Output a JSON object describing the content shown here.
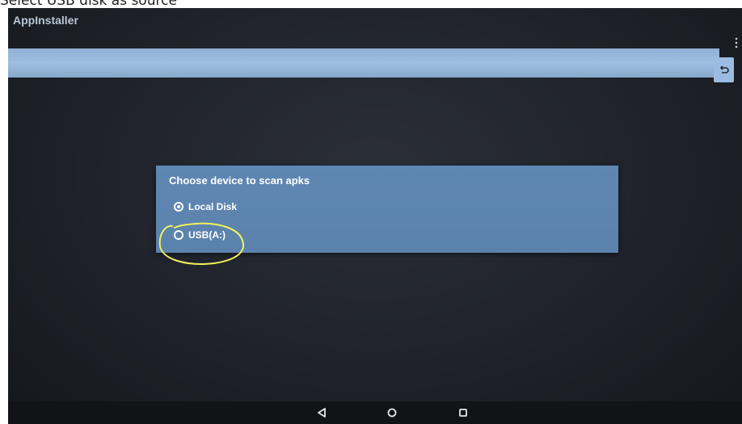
{
  "caption": "Select USB disk as source",
  "app": {
    "title": "AppInstaller"
  },
  "dialog": {
    "title": "Choose device to scan apks",
    "options": [
      {
        "label": "Local Disk",
        "selected": true
      },
      {
        "label": "USB(A:)",
        "selected": false
      }
    ]
  },
  "icons": {
    "overflow": "more-vert-icon",
    "back": "return-arrow-icon",
    "nav": [
      "back-triangle-icon",
      "home-circle-icon",
      "recents-square-icon"
    ]
  },
  "colors": {
    "path_bar": "#9ebfe0",
    "dialog": "#5f87b2",
    "annotation": "#f2f25a"
  }
}
